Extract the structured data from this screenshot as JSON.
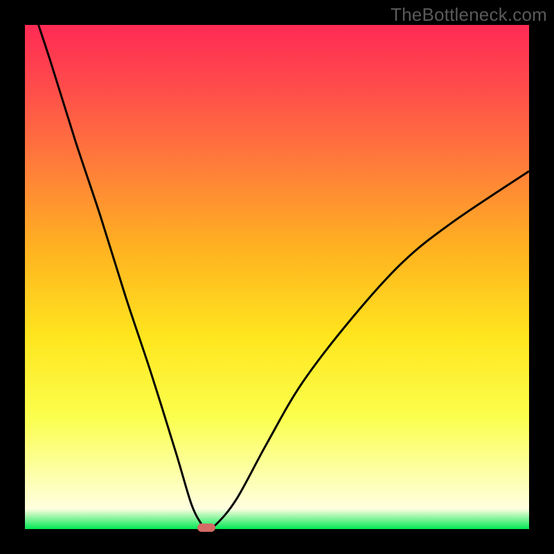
{
  "watermark": "TheBottleneck.com",
  "colors": {
    "background": "#000000",
    "gradient_top": "#ff2a55",
    "gradient_bottom": "#00e853",
    "curve": "#000000",
    "marker": "#d46b65"
  },
  "chart_data": {
    "type": "line",
    "title": "",
    "xlabel": "",
    "ylabel": "",
    "xlim": [
      0,
      100
    ],
    "ylim": [
      0,
      100
    ],
    "x": [
      0,
      5,
      10,
      15,
      20,
      25,
      30,
      33,
      35,
      36,
      38,
      42,
      48,
      55,
      65,
      75,
      85,
      100
    ],
    "values": [
      108,
      93,
      77,
      62,
      46,
      31,
      15,
      5,
      1,
      0,
      1,
      6,
      17,
      29,
      42,
      53,
      61,
      71
    ],
    "min_point": {
      "x": 36,
      "y": 0
    },
    "annotations": []
  }
}
